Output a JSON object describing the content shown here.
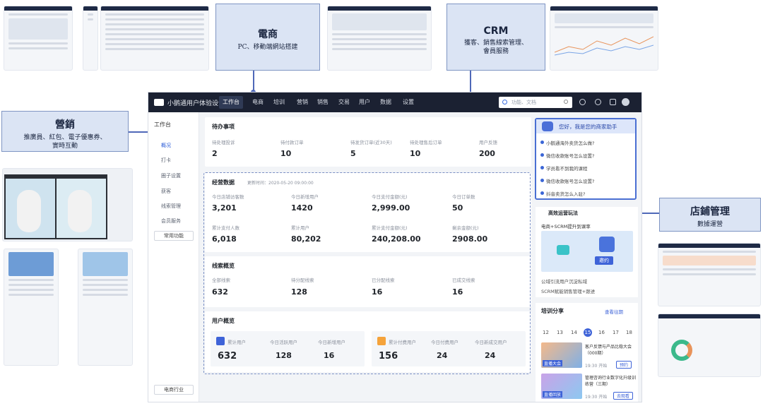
{
  "callouts": {
    "ecommerce": {
      "title": "電商",
      "subtitle": "PC、移動端網站搭建"
    },
    "crm": {
      "title": "CRM",
      "subtitle_line1": "獲客、銷售線索管理、",
      "subtitle_line2": "會員服務"
    },
    "marketing": {
      "title": "營銷",
      "subtitle_line1": "推廣員、紅包、電子優惠券、",
      "subtitle_line2": "實時互動"
    },
    "store": {
      "title": "店鋪管理",
      "subtitle": "數據運營"
    }
  },
  "topbar": {
    "app_name": "小鹅通用户体验设计",
    "nav": [
      "工作台",
      "电商",
      "培训",
      "营销",
      "销售",
      "交易",
      "用户",
      "数据",
      "设置"
    ],
    "search_placeholder": "功能、文档"
  },
  "sidebar": {
    "header": "工作台",
    "items": [
      "概况",
      "打卡",
      "圈子设置",
      "获客",
      "线索管理",
      "会员服务"
    ],
    "common_button": "常用功能",
    "industry": "电商行业"
  },
  "todo": {
    "title": "待办事项",
    "items": [
      {
        "label": "待处理投诉",
        "value": "2"
      },
      {
        "label": "待付款订单",
        "value": "10"
      },
      {
        "label": "待发货订单(近30天)",
        "value": "5"
      },
      {
        "label": "待处理售后订单",
        "value": "10"
      },
      {
        "label": "用户反馈",
        "value": "200"
      }
    ]
  },
  "ops": {
    "title": "经营数据",
    "update_time": "更新时间：2020-05-20 09:00:00",
    "row1": [
      {
        "label": "今日店铺访客数",
        "value": "3,201"
      },
      {
        "label": "今日新增用户",
        "value": "1420"
      },
      {
        "label": "今日支付金额(元)",
        "value": "2,999.00"
      },
      {
        "label": "今日订单数",
        "value": "50"
      }
    ],
    "row2": [
      {
        "label": "累计支付人数",
        "value": "6,018"
      },
      {
        "label": "累计用户",
        "value": "80,202"
      },
      {
        "label": "累计支付金额(元)",
        "value": "240,208.00"
      },
      {
        "label": "剩余金额(元)",
        "value": "2908.00"
      }
    ]
  },
  "leads": {
    "title": "线索概览",
    "items": [
      {
        "label": "全部线索",
        "value": "632"
      },
      {
        "label": "待分配线索",
        "value": "128"
      },
      {
        "label": "已分配线索",
        "value": "16"
      },
      {
        "label": "已成交线索",
        "value": "16"
      }
    ]
  },
  "users": {
    "title": "用户概览",
    "card1": [
      {
        "label": "累计用户",
        "value": "632"
      },
      {
        "label": "今日活跃用户",
        "value": "128"
      },
      {
        "label": "今日新增用户",
        "value": "16"
      }
    ],
    "card2": [
      {
        "label": "累计付费用户",
        "value": "156"
      },
      {
        "label": "今日付费用户",
        "value": "24"
      },
      {
        "label": "今日新成交用户",
        "value": "24"
      }
    ]
  },
  "assistant": {
    "title": "您好，我是您的商家助手",
    "questions": [
      "小鹅通海外卖货怎么做?",
      "微信收款账号怎么设置?",
      "学员看不到我的课程",
      "微信收款账号怎么设置?",
      "抖音卖货怎么入驻?"
    ]
  },
  "promo": {
    "title": "高效运营玩法",
    "subtitle": "电商+SCRM提升到课率",
    "badge": "邀约",
    "links": [
      "公域引流用户沉淀私域",
      "SCRM赋能销售管理+跟进"
    ]
  },
  "training": {
    "title": "培训分享",
    "more": "查看往期",
    "dates": [
      "12",
      "13",
      "14",
      "15",
      "16",
      "17",
      "18"
    ],
    "selected": "15",
    "items": [
      {
        "title": "客户反馈与产品比稳大会（000期）",
        "time": "19:30 开始",
        "action": "预约",
        "tag": "直播大会"
      },
      {
        "title": "管理咨询行业数字化升级训练营（三期）",
        "time": "19:30 开始",
        "action": "去观看",
        "tag": "直播回放"
      }
    ]
  },
  "colors": {
    "accent": "#3e63d8",
    "topbar": "#1b2132",
    "callout_bg": "#dbe4f4",
    "connector": "#4f68b8"
  }
}
